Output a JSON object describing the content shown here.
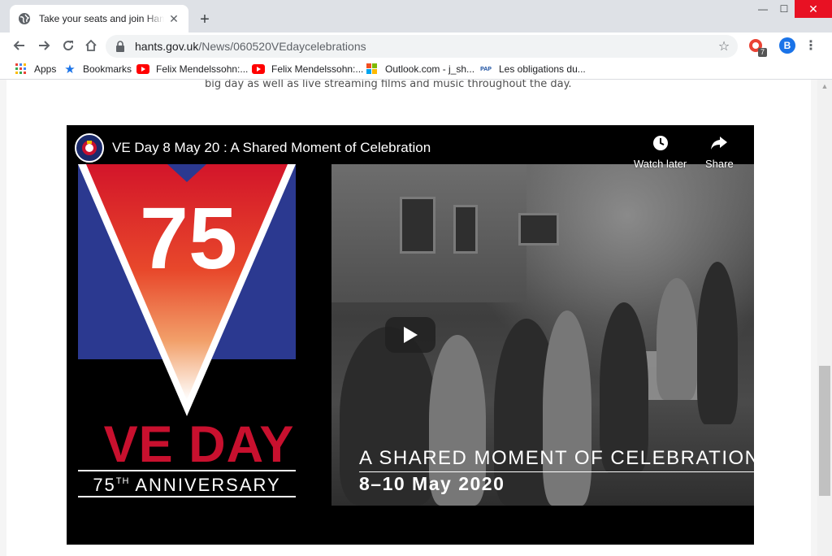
{
  "tab": {
    "title": "Take your seats and join Hampshire",
    "favicon": "globe-icon",
    "close": "✕"
  },
  "window": {
    "minimize": "—",
    "maximize": "☐",
    "close": "✕",
    "new_tab": "+"
  },
  "address": {
    "domain": "hants.gov.uk",
    "path": "/News/060520VEdaycelebrations"
  },
  "extensions": {
    "badge_count": "7",
    "avatar_letter": "B"
  },
  "bookmarks": [
    {
      "label": "Apps",
      "icon": "apps-grid-icon"
    },
    {
      "label": "Bookmarks",
      "icon": "star-icon"
    },
    {
      "label": "Felix Mendelssohn:...",
      "icon": "youtube-icon"
    },
    {
      "label": "Felix Mendelssohn:...",
      "icon": "youtube-icon"
    },
    {
      "label": "Outlook.com - j_sh...",
      "icon": "microsoft-icon"
    },
    {
      "label": "Les obligations du...",
      "icon": "pap-icon"
    }
  ],
  "article": {
    "lead_text": "big day as well as live streaming films and music throughout the day."
  },
  "video": {
    "title": "VE Day 8 May 20 : A Shared Moment of Celebration",
    "watch_later": "Watch later",
    "share": "Share",
    "logo_number": "75",
    "logo_title": "VE DAY",
    "logo_anniversary_num": "75",
    "logo_anniversary_sup": "TH",
    "logo_anniversary_word": "ANNIVERSARY",
    "overlay_title": "A SHARED MOMENT OF CELEBRATION",
    "overlay_dates": "8–10 May 2020"
  },
  "colors": {
    "logo_red": "#c8102e",
    "logo_blue": "#2b3990",
    "youtube_red": "#ff0000"
  }
}
